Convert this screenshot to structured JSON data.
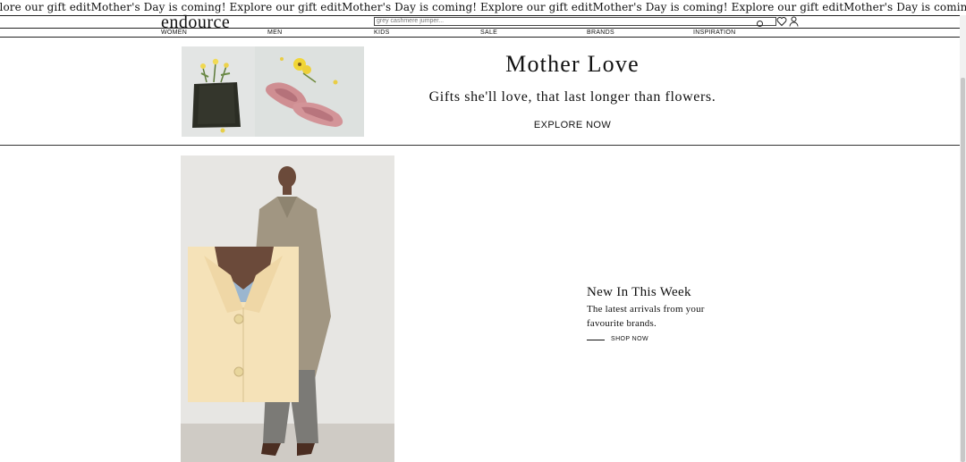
{
  "ticker": {
    "text": "Explore our gift editMother's Day is coming! Explore our gift editMother's Day is coming! Explore our gift editMother's Day is coming! Explore our gift editMother's Day is coming! Explore our gift editMother's Day is coming! Explore our gift editMother's Day is coming!"
  },
  "header": {
    "logo": "endource",
    "search_placeholder": "grey cashmere jumper...",
    "icons": [
      "search-icon",
      "heart-icon",
      "user-icon"
    ]
  },
  "nav": {
    "items": [
      {
        "label": "WOMEN"
      },
      {
        "label": "MEN"
      },
      {
        "label": "KIDS"
      },
      {
        "label": "SALE"
      },
      {
        "label": "BRANDS"
      },
      {
        "label": "INSPIRATION"
      }
    ]
  },
  "promo": {
    "title": "Mother Love",
    "subtitle": "Gifts she'll love, that last longer than flowers.",
    "cta": "EXPLORE NOW"
  },
  "new_in": {
    "title": "New In This Week",
    "description": "The latest arrivals from your favourite brands.",
    "cta": "SHOP NOW"
  },
  "colors": {
    "text": "#111111",
    "background": "#ffffff",
    "rule": "#222222"
  }
}
